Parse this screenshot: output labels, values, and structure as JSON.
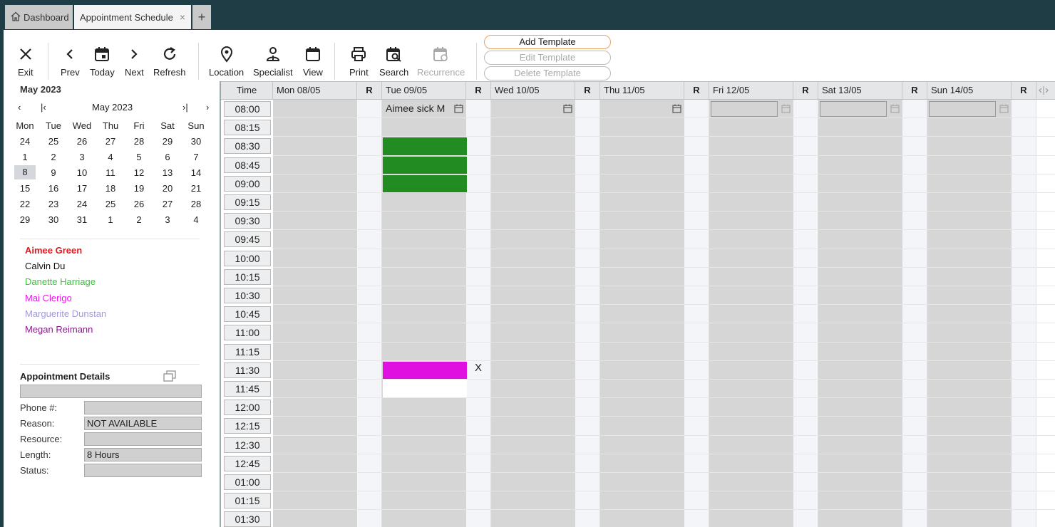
{
  "tabs": [
    {
      "label": "Dashboard"
    },
    {
      "label": "Appointment Schedule",
      "close": "×"
    },
    {
      "label": "+"
    }
  ],
  "toolbar": {
    "exit": "Exit",
    "prev": "Prev",
    "today": "Today",
    "next": "Next",
    "refresh": "Refresh",
    "location": "Location",
    "specialist": "Specialist",
    "view": "View",
    "print": "Print",
    "search": "Search",
    "recurrence": "Recurrence"
  },
  "templates": {
    "add": "Add Template",
    "edit": "Edit Template",
    "delete": "Delete Template"
  },
  "calendar": {
    "title": "May 2023",
    "nav_month": "May 2023",
    "nav_prev": "‹",
    "nav_first": "|‹",
    "nav_last": "›|",
    "nav_next": "›",
    "weekdays": [
      "Mon",
      "Tue",
      "Wed",
      "Thu",
      "Fri",
      "Sat",
      "Sun"
    ],
    "weeks": [
      [
        "24",
        "25",
        "26",
        "27",
        "28",
        "29",
        "30"
      ],
      [
        "1",
        "2",
        "3",
        "4",
        "5",
        "6",
        "7"
      ],
      [
        "8",
        "9",
        "10",
        "11",
        "12",
        "13",
        "14"
      ],
      [
        "15",
        "16",
        "17",
        "18",
        "19",
        "20",
        "21"
      ],
      [
        "22",
        "23",
        "24",
        "25",
        "26",
        "27",
        "28"
      ],
      [
        "29",
        "30",
        "31",
        "1",
        "2",
        "3",
        "4"
      ]
    ],
    "selected": "8"
  },
  "specialists": [
    {
      "name": "Aimee Green",
      "color": "#e8191e",
      "bold": true
    },
    {
      "name": "Calvin Du",
      "color": "#111111",
      "bold": false
    },
    {
      "name": "Danette Harriage",
      "color": "#3cc23c",
      "bold": false
    },
    {
      "name": "Mai Clerigo",
      "color": "#ef14ef",
      "bold": false
    },
    {
      "name": "Marguerite Dunstan",
      "color": "#a09ad6",
      "bold": false
    },
    {
      "name": "Megan Reimann",
      "color": "#8a1b8a",
      "bold": false
    }
  ],
  "details": {
    "title": "Appointment Details",
    "phone_label": "Phone #:",
    "reason_label": "Reason:",
    "reason_value": "NOT AVAILABLE",
    "resource_label": "Resource:",
    "length_label": "Length:",
    "length_value": "8 Hours",
    "status_label": "Status:"
  },
  "schedule": {
    "time_header": "Time",
    "r_header": "R",
    "days": [
      "Mon 08/05",
      "Tue 09/05",
      "Wed 10/05",
      "Thu 11/05",
      "Fri 12/05",
      "Sat 13/05",
      "Sun 14/05"
    ],
    "times": [
      "08:00",
      "08:15",
      "08:30",
      "08:45",
      "09:00",
      "09:15",
      "09:30",
      "09:45",
      "10:00",
      "10:15",
      "10:30",
      "10:45",
      "11:00",
      "11:15",
      "11:30",
      "11:45",
      "12:00",
      "12:15",
      "12:30",
      "12:45",
      "01:00",
      "01:15",
      "01:30"
    ],
    "tue_all_day_text": "Aimee sick M",
    "remove_mark": "X",
    "colors": {
      "green": "#228b22",
      "magenta": "#e010e0"
    }
  }
}
